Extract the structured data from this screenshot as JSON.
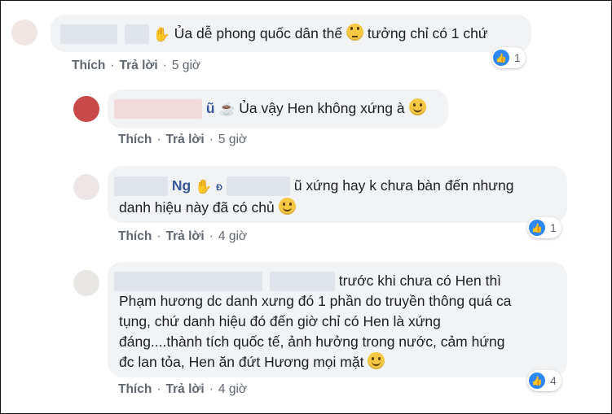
{
  "colors": {
    "name": "#385898",
    "meta": "#606770",
    "bubble": "#f2f3f5",
    "like": "#2d88ff"
  },
  "actions": {
    "like": "Thích",
    "reply": "Trả lời",
    "sep": "·"
  },
  "comments": [
    {
      "name_tail": "",
      "lines": [
        "Ủa dễ phong quốc dân thế",
        "tưởng chỉ có 1 chứ"
      ],
      "time": "5 giờ",
      "reactions": "1"
    },
    {
      "name_tail": "ũ",
      "lines": [
        "Ủa vậy Hen không xứng à"
      ],
      "time": "5 giờ",
      "reactions": ""
    },
    {
      "name_tail": "Ng",
      "name_mark": "Đ",
      "lines": [
        "ũ xứng hay k chưa bàn đến nhưng",
        "danh hiệu này đã có chủ"
      ],
      "time": "4 giờ",
      "reactions": "1"
    },
    {
      "name_tail": "",
      "lines": [
        "trước khi chưa có Hen thì",
        "Phạm hương dc danh xưng đó 1 phần do truyền thông quá ca",
        "tụng, chứ danh hiệu đó đến giờ chỉ có Hen là xứng",
        "đáng....thành tích quốc tế, ảnh hưởng trong nước, cảm hứng",
        "đc lan tỏa, Hen ăn đứt Hương mọi mặt"
      ],
      "time": "4 giờ",
      "reactions": "4"
    }
  ]
}
